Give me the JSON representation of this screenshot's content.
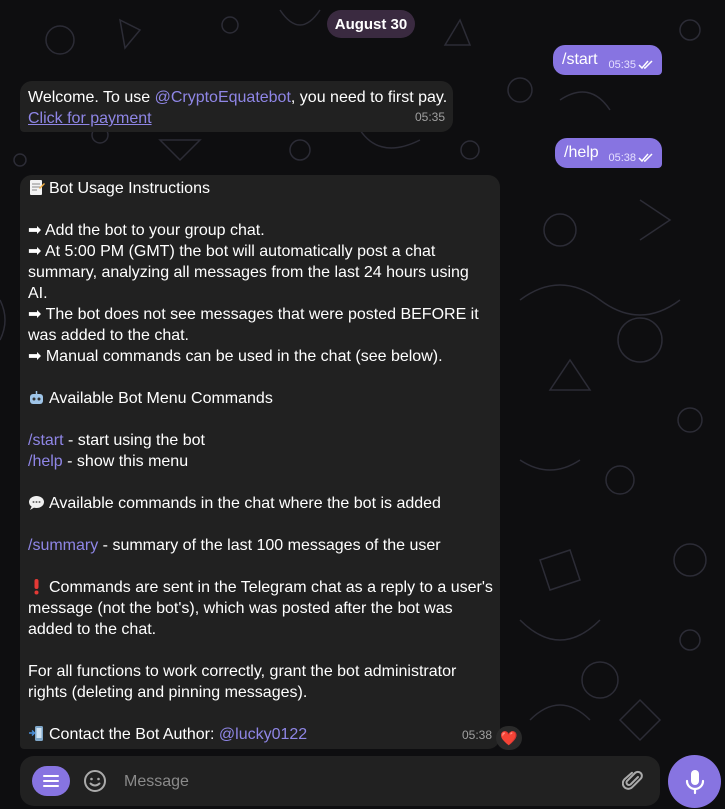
{
  "date_label": "August 30",
  "messages": {
    "start": {
      "text": "/start",
      "time": "05:35"
    },
    "welcome": {
      "text_before": "Welcome. To use ",
      "mention": "@CryptoEquatebot",
      "text_after": ", you need to first pay.",
      "link": "Click for payment",
      "time": "05:35"
    },
    "help": {
      "text": "/help",
      "time": "05:38"
    },
    "instructions": {
      "lines": [
        {
          "emoji": "memo-icon",
          "text": "Bot Usage Instructions"
        },
        {
          "text": "➡ Add the bot to your group chat."
        },
        {
          "text": "➡ At 5:00 PM (GMT) the bot will automatically post a chat"
        },
        {
          "text": "summary, analyzing all messages from the last 24 hours using"
        },
        {
          "text": "AI."
        },
        {
          "text": "➡ The bot does not see messages that were posted BEFORE it"
        },
        {
          "text": "was added to the chat."
        },
        {
          "text": "➡ Manual commands can be used in the chat (see below)."
        },
        {
          "emoji": "robot-icon",
          "text": "Available Bot Menu Commands"
        },
        {
          "cmd": "/start",
          "text": " - start using the bot"
        },
        {
          "cmd": "/help",
          "text": " - show this menu"
        },
        {
          "emoji": "speech-balloon-icon",
          "text": "Available commands in the chat where the bot is added"
        },
        {
          "cmd": "/summary",
          "text": " - summary of the last 100 messages of the user"
        },
        {
          "emoji": "exclamation-icon",
          "text": "Commands are sent in the Telegram chat as a reply to a user's"
        },
        {
          "text": "message (not the bot's), which was posted after the bot was"
        },
        {
          "text": "added to the chat."
        },
        {
          "text": "For all functions to work correctly, grant the bot administrator"
        },
        {
          "text": "rights (deleting and pinning messages)."
        },
        {
          "emoji": "phone-arrow-icon",
          "text": "Contact the Bot Author: ",
          "mention": "@lucky0122"
        }
      ],
      "time": "05:38",
      "reaction": "❤️"
    }
  },
  "composer": {
    "placeholder": "Message"
  },
  "colors": {
    "accent": "#8774e1",
    "bubble_in": "#212121",
    "link": "#8f86e6",
    "background": "#0e0e10"
  }
}
